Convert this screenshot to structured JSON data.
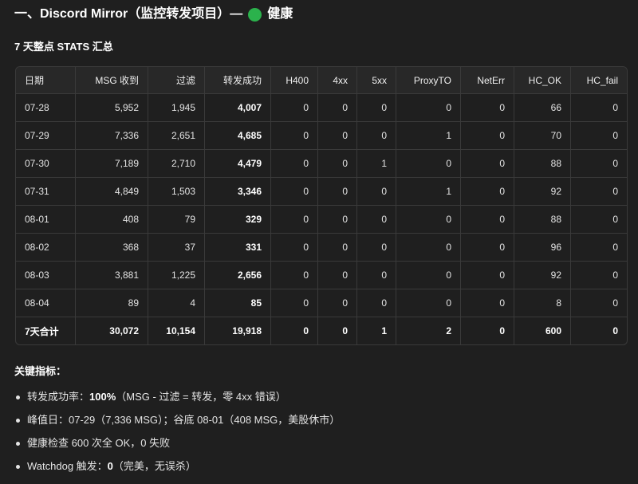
{
  "heading": {
    "title": "一、Discord Mirror（监控转发项目）—",
    "status_icon": "green-circle-icon",
    "status_text": "健康"
  },
  "stats_title": "7 天整点 STATS 汇总",
  "table": {
    "columns": [
      "日期",
      "MSG 收到",
      "过滤",
      "转发成功",
      "H400",
      "4xx",
      "5xx",
      "ProxyTO",
      "NetErr",
      "HC_OK",
      "HC_fail"
    ],
    "rows": [
      {
        "date": "07-28",
        "msg_received": "5,952",
        "filtered": "1,945",
        "forwarded": "4,007",
        "h400": "0",
        "e4xx": "0",
        "e5xx": "0",
        "proxy_to": "0",
        "net_err": "0",
        "hc_ok": "66",
        "hc_fail": "0"
      },
      {
        "date": "07-29",
        "msg_received": "7,336",
        "filtered": "2,651",
        "forwarded": "4,685",
        "h400": "0",
        "e4xx": "0",
        "e5xx": "0",
        "proxy_to": "1",
        "net_err": "0",
        "hc_ok": "70",
        "hc_fail": "0"
      },
      {
        "date": "07-30",
        "msg_received": "7,189",
        "filtered": "2,710",
        "forwarded": "4,479",
        "h400": "0",
        "e4xx": "0",
        "e5xx": "1",
        "proxy_to": "0",
        "net_err": "0",
        "hc_ok": "88",
        "hc_fail": "0"
      },
      {
        "date": "07-31",
        "msg_received": "4,849",
        "filtered": "1,503",
        "forwarded": "3,346",
        "h400": "0",
        "e4xx": "0",
        "e5xx": "0",
        "proxy_to": "1",
        "net_err": "0",
        "hc_ok": "92",
        "hc_fail": "0"
      },
      {
        "date": "08-01",
        "msg_received": "408",
        "filtered": "79",
        "forwarded": "329",
        "h400": "0",
        "e4xx": "0",
        "e5xx": "0",
        "proxy_to": "0",
        "net_err": "0",
        "hc_ok": "88",
        "hc_fail": "0"
      },
      {
        "date": "08-02",
        "msg_received": "368",
        "filtered": "37",
        "forwarded": "331",
        "h400": "0",
        "e4xx": "0",
        "e5xx": "0",
        "proxy_to": "0",
        "net_err": "0",
        "hc_ok": "96",
        "hc_fail": "0"
      },
      {
        "date": "08-03",
        "msg_received": "3,881",
        "filtered": "1,225",
        "forwarded": "2,656",
        "h400": "0",
        "e4xx": "0",
        "e5xx": "0",
        "proxy_to": "0",
        "net_err": "0",
        "hc_ok": "92",
        "hc_fail": "0"
      },
      {
        "date": "08-04",
        "msg_received": "89",
        "filtered": "4",
        "forwarded": "85",
        "h400": "0",
        "e4xx": "0",
        "e5xx": "0",
        "proxy_to": "0",
        "net_err": "0",
        "hc_ok": "8",
        "hc_fail": "0"
      }
    ],
    "totals": {
      "label": "7天合计",
      "msg_received": "30,072",
      "filtered": "10,154",
      "forwarded": "19,918",
      "h400": "0",
      "e4xx": "0",
      "e5xx": "1",
      "proxy_to": "2",
      "net_err": "0",
      "hc_ok": "600",
      "hc_fail": "0"
    }
  },
  "key_metrics": {
    "title": "关键指标：",
    "items": [
      {
        "label": "转发成功率：",
        "value": "100%",
        "note": "（MSG - 过滤 = 转发，零 4xx 错误）"
      },
      {
        "text": "峰值日：07-29（7,336 MSG）；谷底 08-01（408 MSG，美股休市）"
      },
      {
        "text": "健康检查 600 次全 OK，0 失败"
      },
      {
        "label": "Watchdog 触发：",
        "value": "0",
        "note": "（完美，无误杀）"
      }
    ]
  },
  "colors": {
    "status_green": "#2bb24c"
  }
}
